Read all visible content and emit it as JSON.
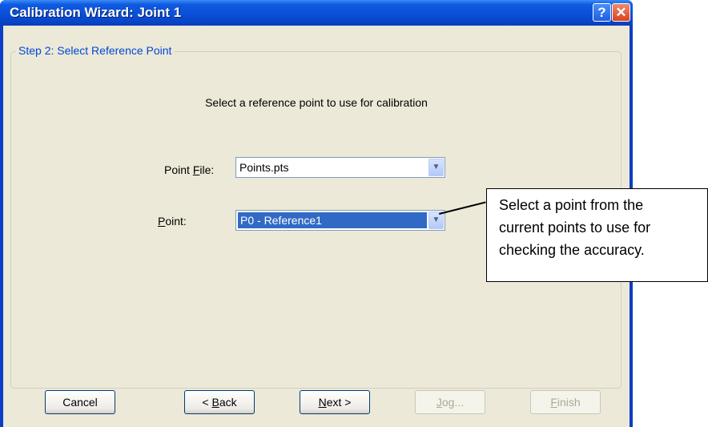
{
  "window": {
    "title": "Calibration Wizard: Joint 1",
    "help_glyph": "?",
    "close_glyph": "✕"
  },
  "group": {
    "legend": "Step 2: Select Reference Point"
  },
  "instruction": "Select a reference point to use for calibration",
  "point_file": {
    "label_pre": "Point ",
    "label_key": "F",
    "label_post": "ile:",
    "value": "Points.pts"
  },
  "point": {
    "label_key": "P",
    "label_post": "oint:",
    "value": "P0 - Reference1"
  },
  "dropdown_glyph": "▼",
  "buttons": {
    "cancel": "Cancel",
    "back_pre": "< ",
    "back_key": "B",
    "back_post": "ack",
    "next_key": "N",
    "next_post": "ext >",
    "jog_key": "J",
    "jog_post": "og...",
    "finish_key": "F",
    "finish_post": "inish"
  },
  "callout": {
    "line1": "Select a point from the",
    "line2": "current points to use for",
    "line3": "checking the accuracy."
  }
}
